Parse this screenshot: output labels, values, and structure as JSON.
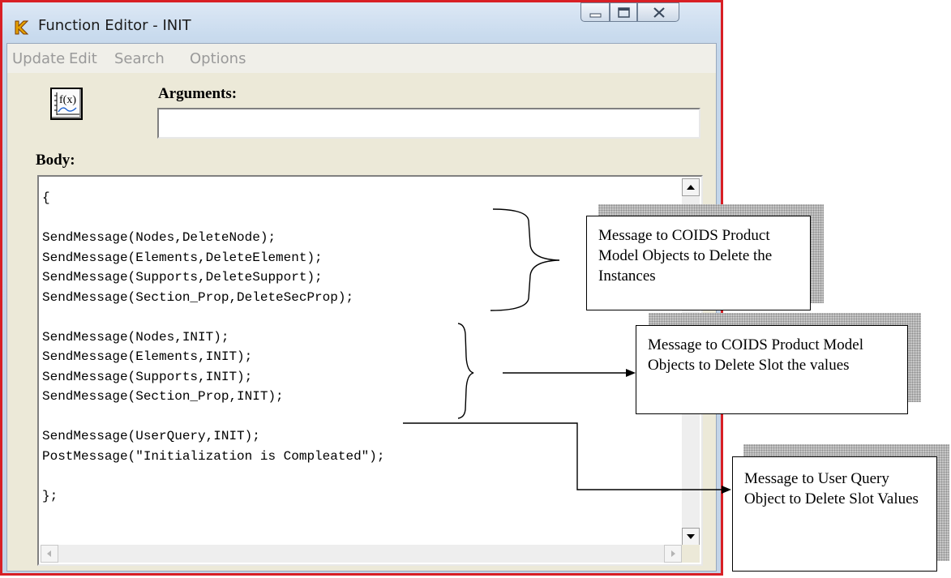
{
  "window": {
    "title": "Function Editor - INIT",
    "app_icon": "k-logo-icon",
    "controls": [
      "minimize-icon",
      "maximize-icon",
      "close-icon"
    ]
  },
  "menu": {
    "items": [
      "Update",
      "Edit",
      "Search",
      "Options"
    ]
  },
  "editor": {
    "function_button_icon": "function-graph-icon",
    "arguments_label": "Arguments:",
    "arguments_value": "",
    "body_label": "Body:",
    "body_lines": [
      "{",
      "",
      "SendMessage(Nodes,DeleteNode);",
      "SendMessage(Elements,DeleteElement);",
      "SendMessage(Supports,DeleteSupport);",
      "SendMessage(Section_Prop,DeleteSecProp);",
      "",
      "SendMessage(Nodes,INIT);",
      "SendMessage(Elements,INIT);",
      "SendMessage(Supports,INIT);",
      "SendMessage(Section_Prop,INIT);",
      "",
      "SendMessage(UserQuery,INIT);",
      "PostMessage(\"Initialization is Compleated\");",
      "",
      "};"
    ]
  },
  "annotations": [
    {
      "text": "Message to COIDS Product Model Objects to Delete the Instances"
    },
    {
      "text": "Message to COIDS Product Model Objects to Delete Slot the values"
    },
    {
      "text": "Message to User Query Object to Delete Slot Values"
    }
  ],
  "colors": {
    "window_border": "#d81f25",
    "title_gradient": "#c9dbee",
    "client_background": "#ece9d8",
    "menu_text_disabled": "#9a9a9a"
  }
}
